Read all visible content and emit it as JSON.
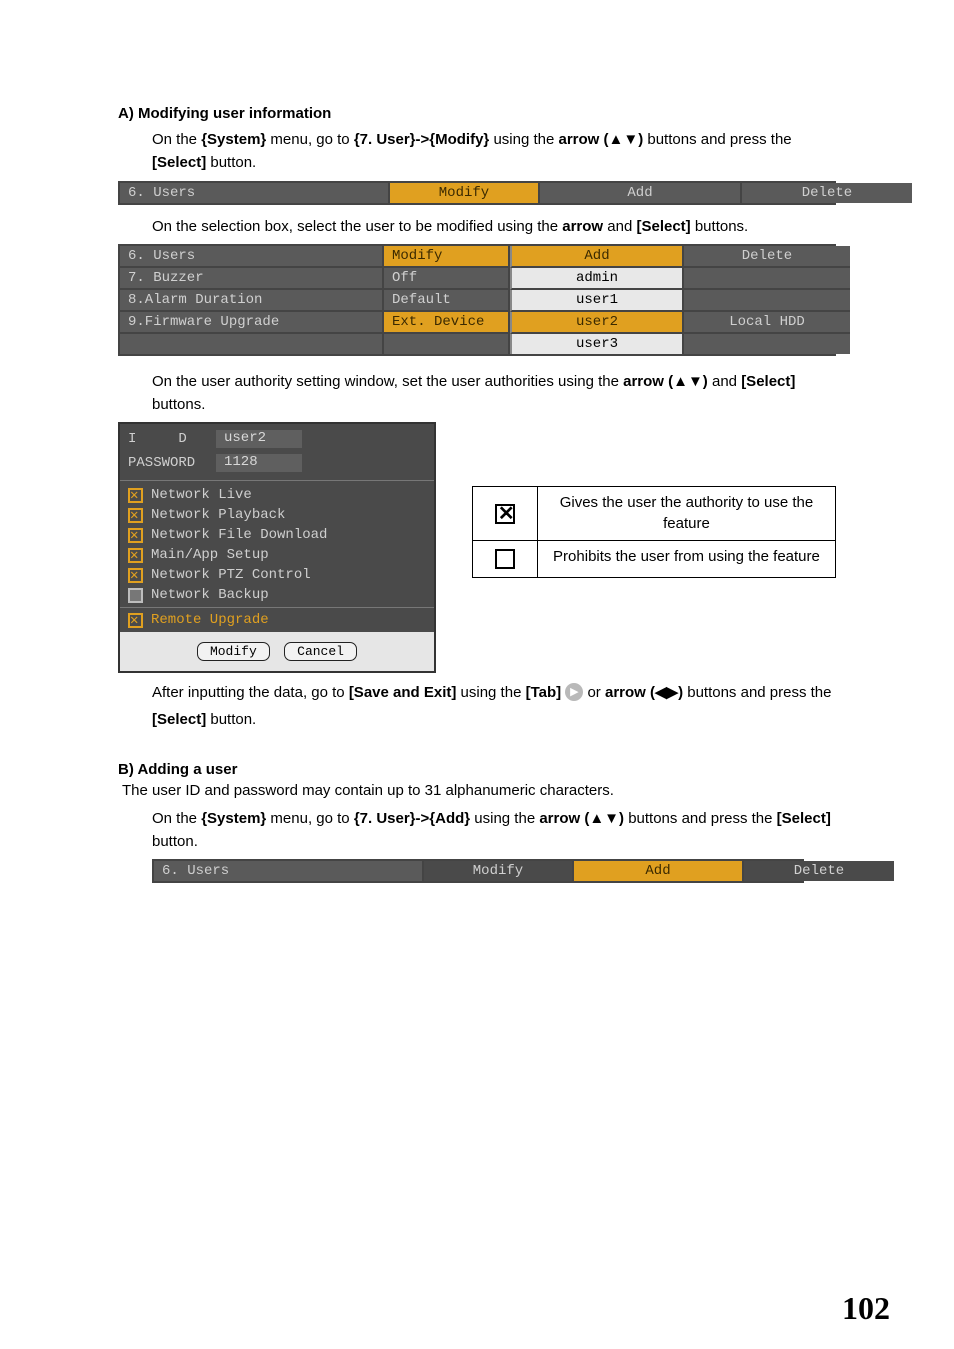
{
  "sectionA": {
    "heading": "A) Modifying user information",
    "para1_pre": "On the ",
    "para1_b1": "{System}",
    "para1_mid1": " menu, go to ",
    "para1_b2": "{7. User}->{Modify}",
    "para1_mid2": " using the ",
    "para1_b3": "arrow (▲▼)",
    "para1_mid3": " buttons and press the ",
    "para1_b4": "[Select]",
    "para1_end": " button.",
    "bar1": {
      "c1": "6. Users",
      "c2": "Modify",
      "c3": "Add",
      "c4": "Delete"
    },
    "para2_pre": "On the selection box, select the user to be modified using the ",
    "para2_b1": "arrow",
    "para2_mid": " and ",
    "para2_b2": "[Select]",
    "para2_end": " buttons.",
    "selTable": {
      "rows": [
        {
          "left": "6. Users",
          "val": "Modify",
          "user": "Add",
          "right": "Delete",
          "hlVal": true,
          "userTop": true
        },
        {
          "left": "7. Buzzer",
          "val": "Off",
          "user": "admin",
          "right": ""
        },
        {
          "left": "8.Alarm Duration",
          "val": "Default",
          "user": "user1",
          "right": ""
        },
        {
          "left": "9.Firmware Upgrade",
          "val": "Ext. Device",
          "user": "user2",
          "right": "Local HDD",
          "hlUser": true,
          "hlVal": true
        },
        {
          "left": "",
          "val": "",
          "user": "user3",
          "right": "",
          "blankLeft": true
        }
      ]
    },
    "para3_pre": "On the user authority setting window, set the user authorities using the ",
    "para3_b1": "arrow (▲▼)",
    "para3_mid": " and ",
    "para3_b2": "[Select]",
    "para3_end": " buttons.",
    "authWin": {
      "idLabel": "I     D",
      "idValue": "user2",
      "pwLabel": "PASSWORD",
      "pwValue": "1128",
      "items": [
        {
          "label": "Network Live",
          "checked": true
        },
        {
          "label": "Network Playback",
          "checked": true
        },
        {
          "label": "Network File Download",
          "checked": true
        },
        {
          "label": "Main/App Setup",
          "checked": true
        },
        {
          "label": "Network PTZ Control",
          "checked": true
        },
        {
          "label": "Network Backup",
          "checked": false,
          "gray": true
        },
        {
          "label": "Remote Upgrade",
          "checked": true,
          "special": true
        }
      ],
      "btnModify": "Modify",
      "btnCancel": "Cancel"
    },
    "legend": {
      "row1": "Gives the user the authority to use the feature",
      "row2": "Prohibits the user from using the feature"
    },
    "para4_pre": "After inputting the data, go to ",
    "para4_b1": "[Save and Exit]",
    "para4_mid1": " using the ",
    "para4_b2": "[Tab]",
    "para4_mid2": " or ",
    "para4_b3": "arrow (◀▶)",
    "para4_mid3": " buttons and press the ",
    "para4_b4": "[Select]",
    "para4_end": " button."
  },
  "sectionB": {
    "heading": "B) Adding a user",
    "line1": "The user ID and password may contain up to 31 alphanumeric characters.",
    "para1_pre": "On the ",
    "para1_b1": "{System}",
    "para1_mid1": " menu, go to ",
    "para1_b2": "{7. User}->{Add}",
    "para1_mid2": " using the ",
    "para1_b3": "arrow (▲▼)",
    "para1_mid3": " buttons and press the ",
    "para1_b4": "[Select]",
    "para1_end": " button.",
    "bar": {
      "c1": "6. Users",
      "c2": "Modify",
      "c3": "Add",
      "c4": "Delete"
    }
  },
  "pageNumber": "102",
  "tabGlyph": "▶"
}
